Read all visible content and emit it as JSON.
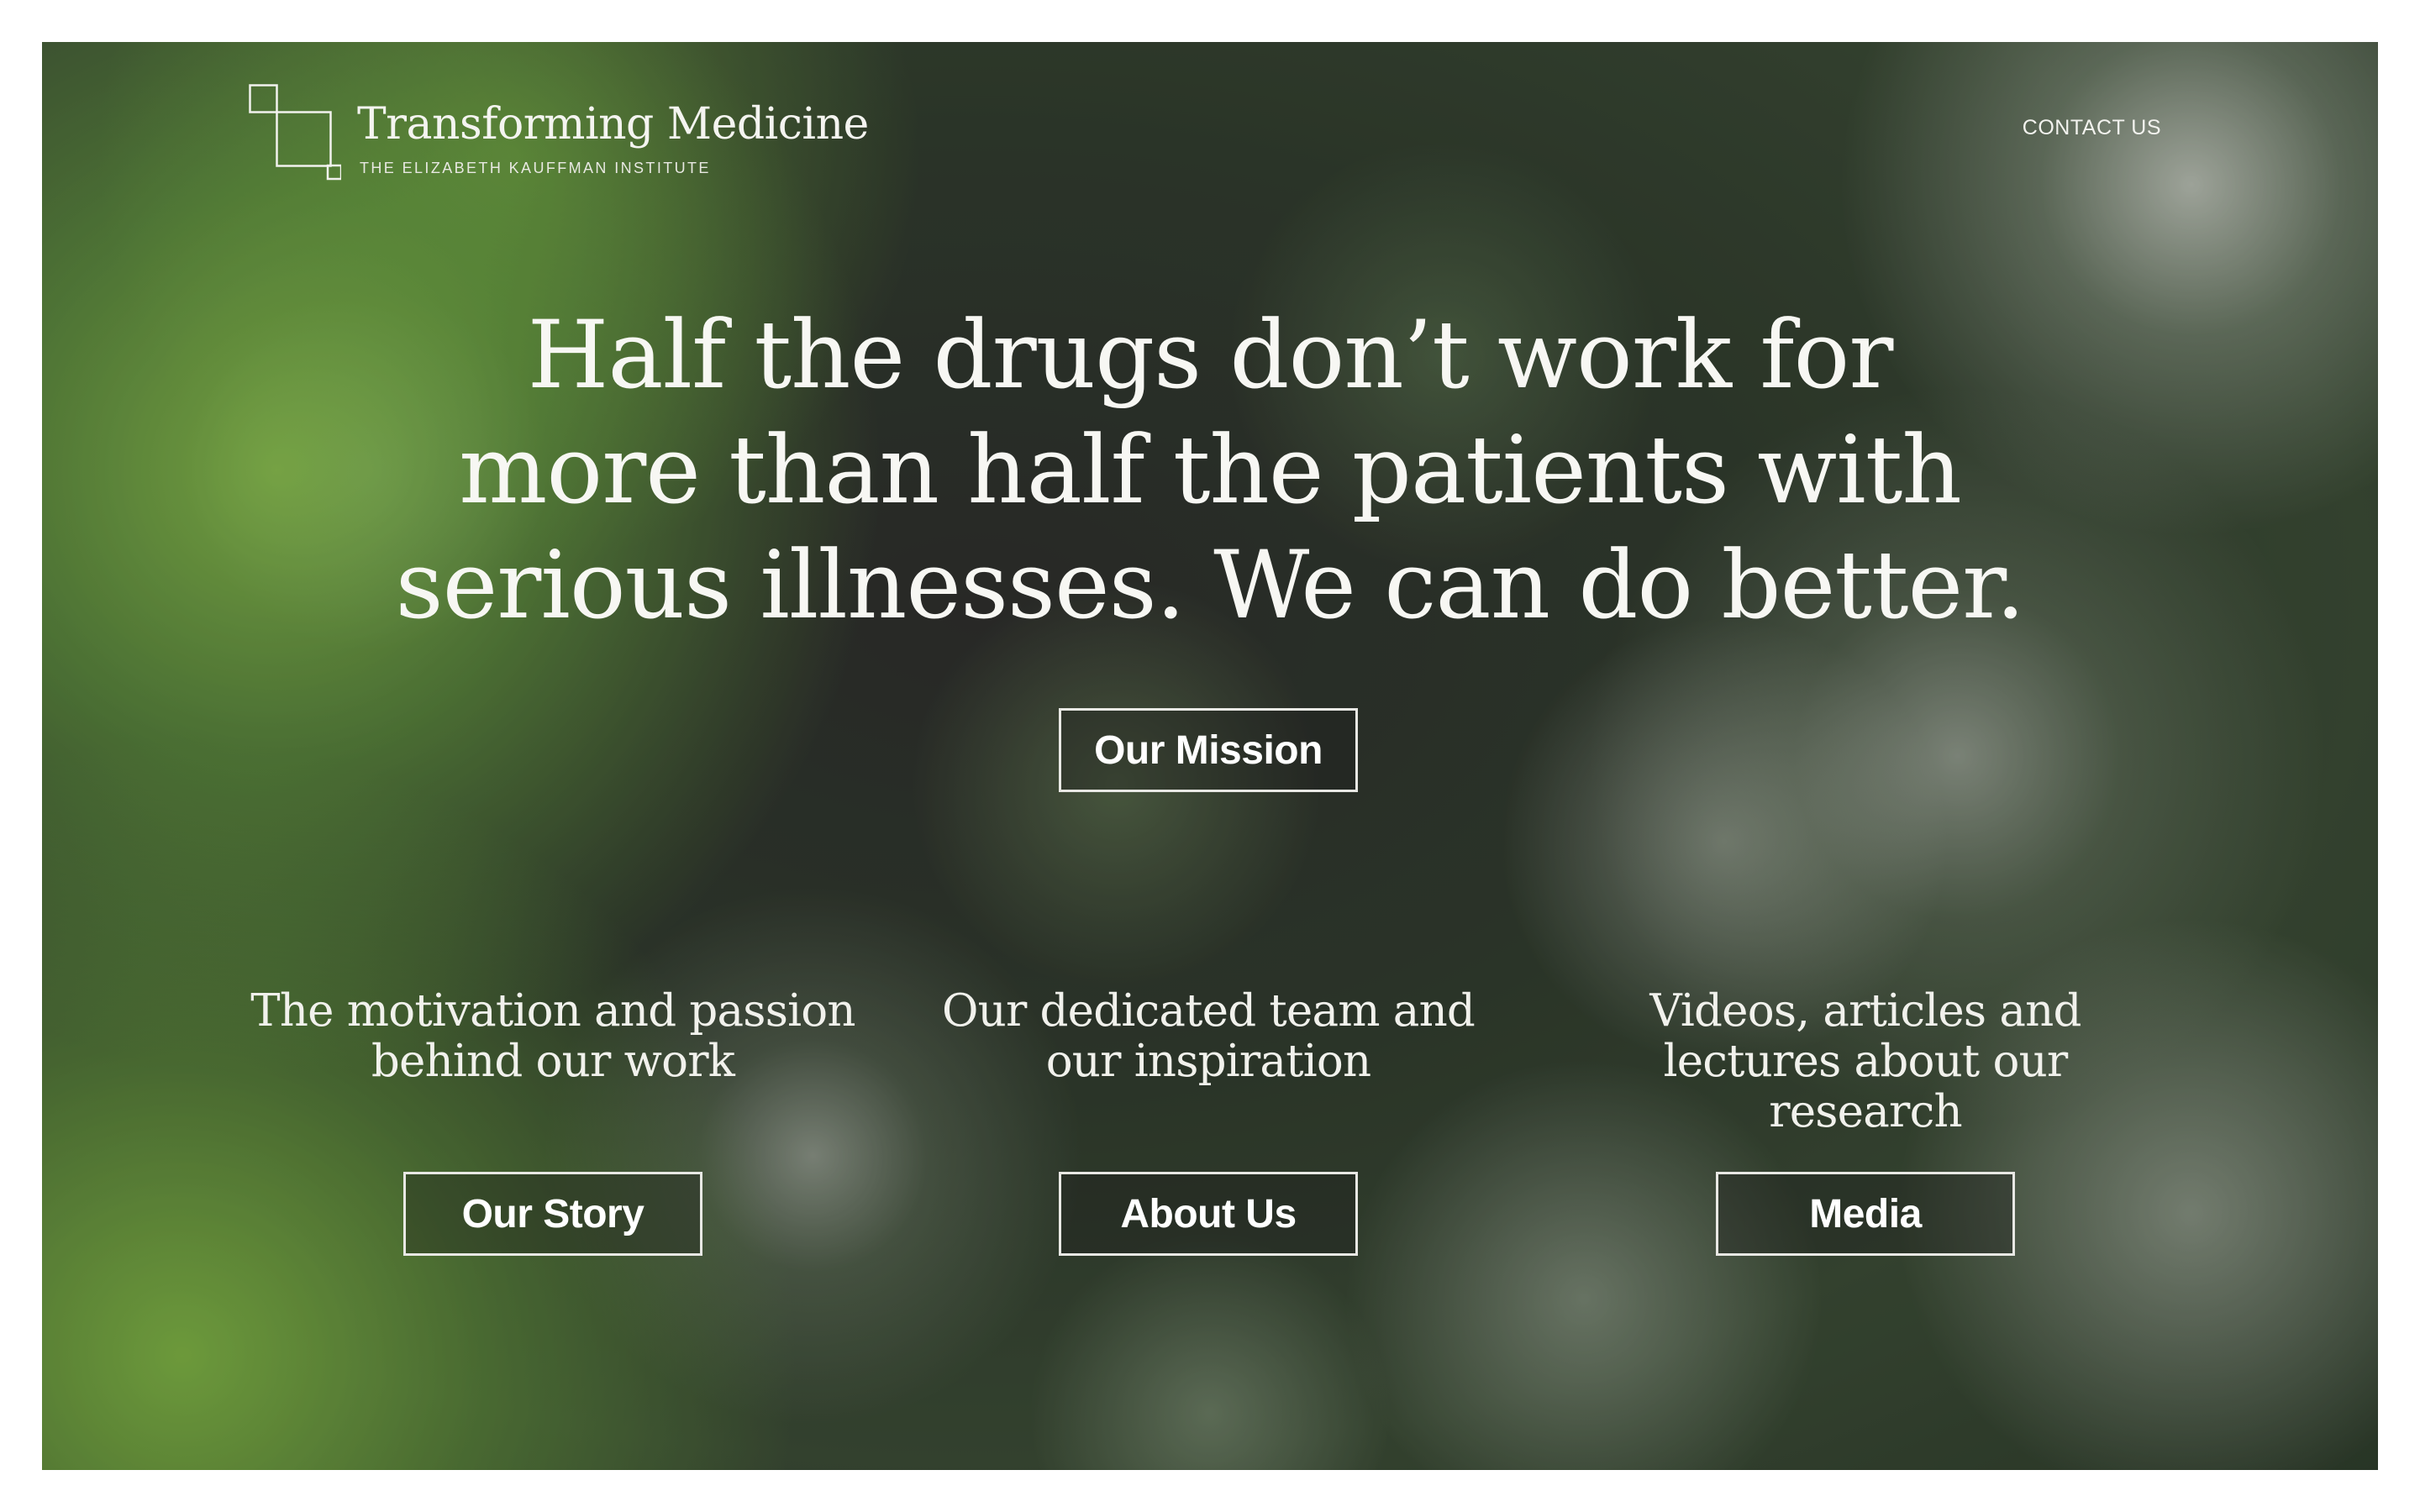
{
  "header": {
    "logo_title": "Transforming Medicine",
    "logo_subtitle": "THE ELIZABETH KAUFFMAN INSTITUTE",
    "logo_icon": "overlapping-squares-icon",
    "contact_label": "CONTACT US"
  },
  "hero": {
    "headline_lines": [
      "Half the drugs don’t work for",
      "more than half the patients with",
      "serious illnesses. We can do better."
    ],
    "mission_button": "Our Mission"
  },
  "columns": [
    {
      "text": "The motivation and passion behind our work",
      "button": "Our Story"
    },
    {
      "text": "Our dedicated team and our inspiration",
      "button": "About Us"
    },
    {
      "text": "Videos, articles and lectures about our research",
      "button": "Media"
    }
  ],
  "colors": {
    "text": "#f7f7f3",
    "button_border": "#e8e8e4",
    "background_dark": "#2b3528",
    "accent_green": "#8cc850"
  }
}
